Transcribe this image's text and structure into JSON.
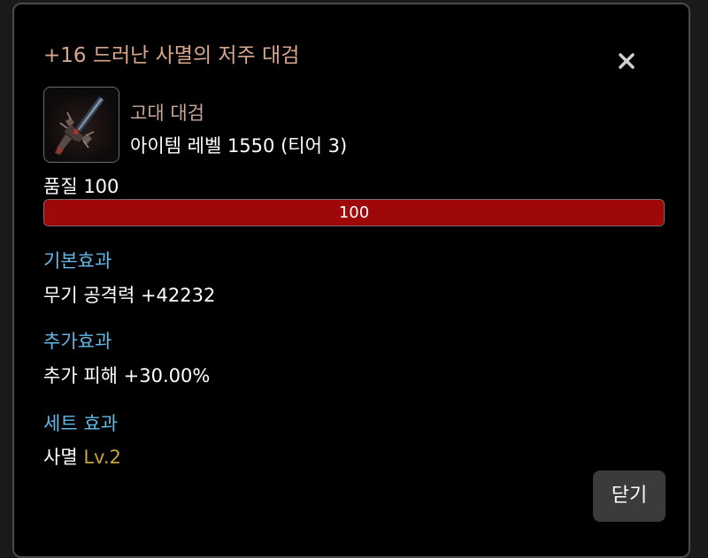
{
  "item": {
    "title": "+16 드러난 사멸의 저주 대검",
    "type": "고대 대검",
    "level": "아이템 레벨 1550 (티어 3)",
    "icon": "greatsword-icon"
  },
  "quality": {
    "label": "품질 100",
    "value": 100,
    "value_text": "100",
    "bar_color": "#9e0808"
  },
  "sections": {
    "base": {
      "heading": "기본효과",
      "text": "무기 공격력 +42232"
    },
    "bonus": {
      "heading": "추가효과",
      "text": "추가 피해 +30.00%"
    },
    "set": {
      "heading": "세트 효과",
      "name": "사멸",
      "level": "Lv.2"
    }
  },
  "buttons": {
    "close_label": "닫기",
    "close_icon": "close-icon"
  },
  "colors": {
    "title": "#d7a68d",
    "section_heading": "#63b8e6",
    "set_level": "#c8a23b"
  }
}
